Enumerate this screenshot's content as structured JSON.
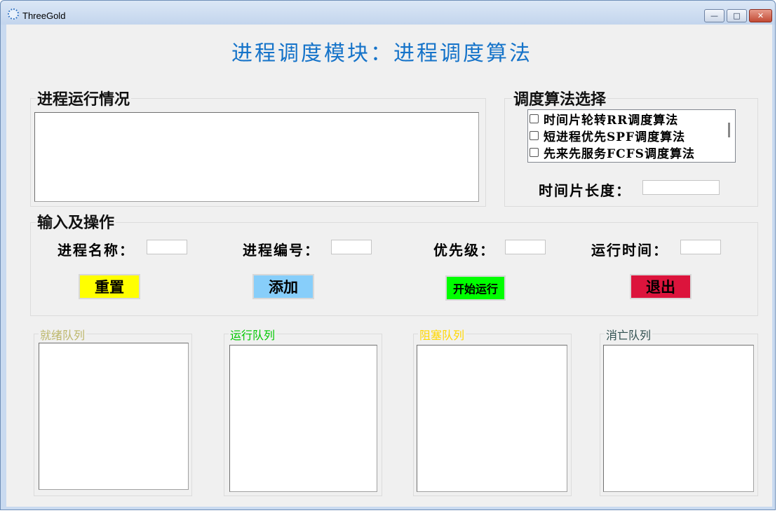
{
  "window": {
    "title": "ThreeGold",
    "minimize": "—",
    "maximize": "□",
    "close": "✕"
  },
  "page_title": "进程调度模块：进程调度算法",
  "run_status": {
    "legend": "进程运行情况",
    "content": ""
  },
  "algorithm": {
    "legend": "调度算法选择",
    "options": [
      {
        "label": "时间片轮转RR调度算法",
        "checked": false
      },
      {
        "label": "短进程优先SPF调度算法",
        "checked": false
      },
      {
        "label": "先来先服务FCFS调度算法",
        "checked": false
      }
    ],
    "time_slice_label": "时间片长度：",
    "time_slice_value": ""
  },
  "operation": {
    "legend": "输入及操作",
    "fields": [
      {
        "label": "进程名称：",
        "value": ""
      },
      {
        "label": "进程编号：",
        "value": ""
      },
      {
        "label": "优先级：",
        "value": ""
      },
      {
        "label": "运行时间：",
        "value": ""
      }
    ],
    "buttons": {
      "reset": {
        "label": "重置",
        "color": "#ffff00"
      },
      "add": {
        "label": "添加",
        "color": "#87cefa"
      },
      "start": {
        "label": "开始运行",
        "color": "#00ff00"
      },
      "exit": {
        "label": "退出",
        "color": "#dc143c"
      }
    }
  },
  "queues": {
    "ready": {
      "label": "就绪队列",
      "color": "#bdb76b"
    },
    "running": {
      "label": "运行队列",
      "color": "#00c800"
    },
    "blocked": {
      "label": "阻塞队列",
      "color": "#ffd700"
    },
    "dead": {
      "label": "消亡队列",
      "color": "#2f4f4f"
    }
  }
}
